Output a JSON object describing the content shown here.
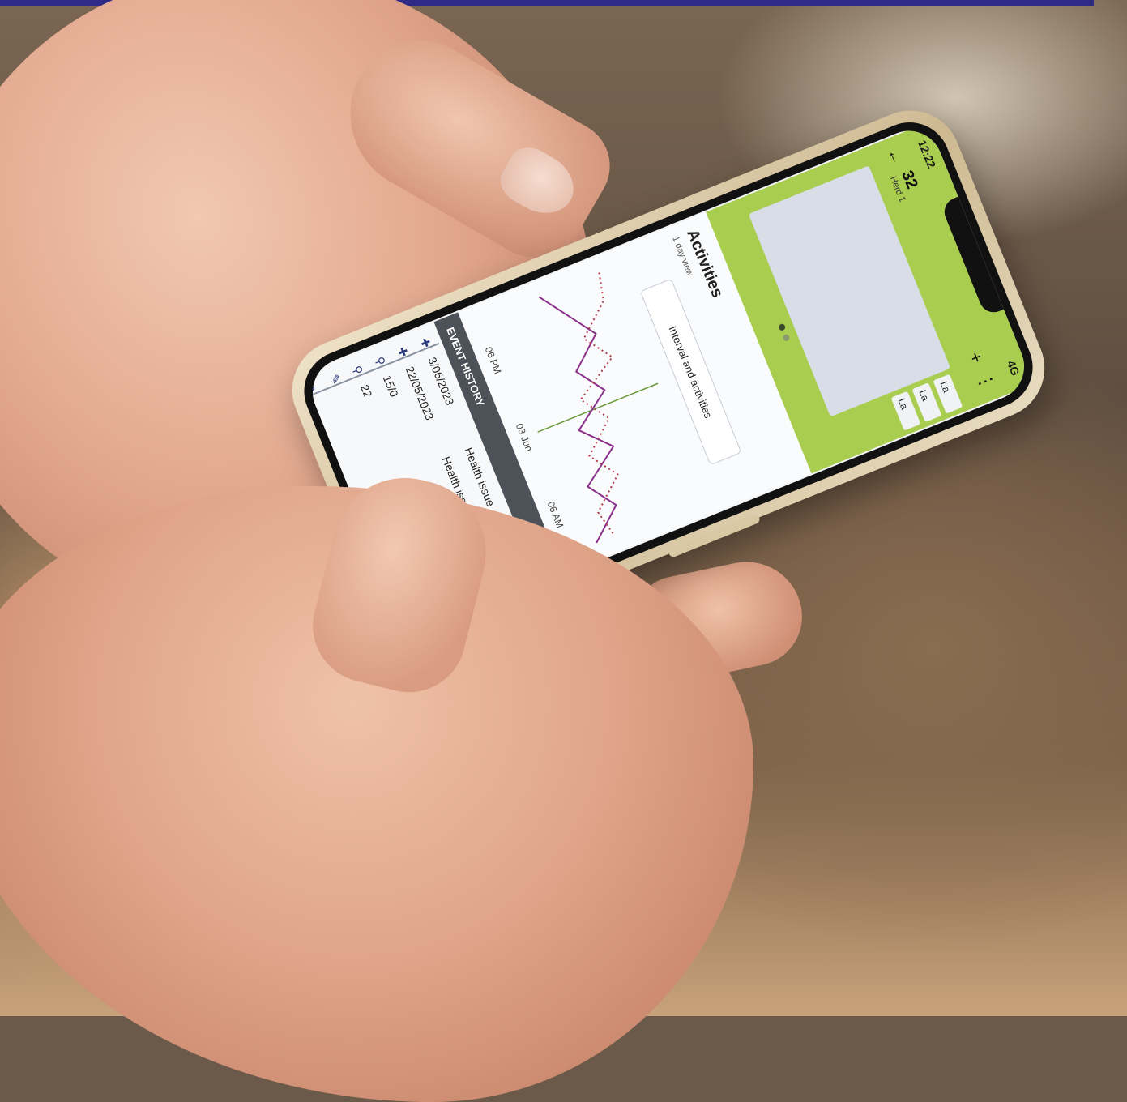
{
  "colors": {
    "accent_green": "#a9cd4f",
    "event_bar": "#4c5258",
    "frame_border": "#2f2a86",
    "solid_series": "#8a2f8a",
    "dotted_series": "#b33b4a",
    "midnight_line": "#6a9a3a"
  },
  "status_bar": {
    "time": "12:22",
    "signal": "4G"
  },
  "header": {
    "back_icon": "back-arrow-icon",
    "animal_number": "32",
    "group": "Herd 1",
    "add_icon": "plus-icon",
    "more_icon": "more-vertical-icon",
    "side_labels": [
      "La",
      "La",
      "La"
    ]
  },
  "activities": {
    "title": "Activities",
    "subtitle": "1 day view",
    "button_label": "Interval and activities",
    "x_labels": [
      "06 PM",
      "03 Jun",
      "06 AM"
    ]
  },
  "chart_data": {
    "type": "line",
    "title": "Activities",
    "categories": [
      "06 PM",
      "03 Jun",
      "06 AM"
    ],
    "series": [
      {
        "values": [
          40,
          55,
          70,
          45,
          60,
          30,
          50,
          20,
          35,
          10
        ]
      },
      {
        "values": [
          90,
          85,
          60,
          75,
          40,
          55,
          30,
          45,
          20,
          25
        ]
      }
    ],
    "ylim": [
      0,
      100
    ],
    "grid": false
  },
  "event_history": {
    "title": "EVENT HISTORY",
    "rows": [
      {
        "icon": "medical-bag-icon",
        "date": "3/06/2023",
        "type": "Health issue"
      },
      {
        "icon": "medical-bag-icon",
        "date": "22/05/2023",
        "type": "Health issue"
      },
      {
        "icon": "location-pin-icon",
        "date": "15/0",
        "type": ""
      },
      {
        "icon": "location-pin-icon",
        "date": "22",
        "type": ""
      },
      {
        "icon": "syringe-icon",
        "date": "",
        "type": ""
      },
      {
        "icon": "drop-icon",
        "date": "",
        "type": ""
      }
    ]
  }
}
